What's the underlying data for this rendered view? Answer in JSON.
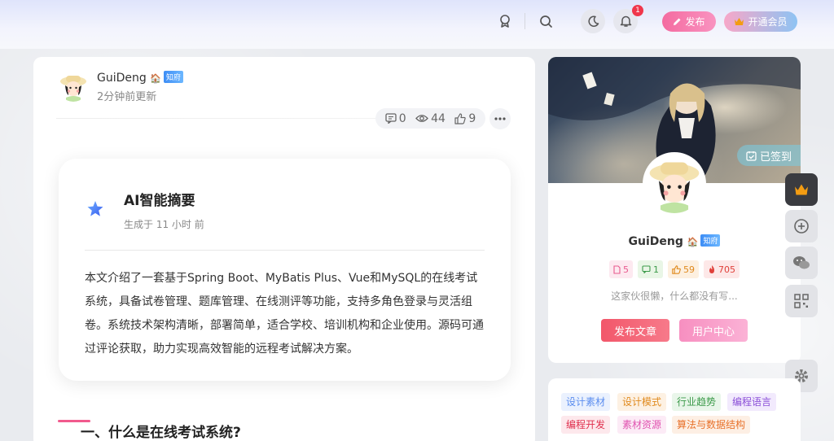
{
  "header": {
    "publish_label": "发布",
    "vip_label": "开通会员",
    "notification_count": "1"
  },
  "article": {
    "author": "GuiDeng",
    "author_badge": "知府",
    "update_time": "2分钟前更新",
    "comments": "0",
    "views": "44",
    "likes": "9",
    "ai_summary": {
      "title": "AI智能摘要",
      "subtitle": "生成于 11 小时 前",
      "body": "本文介绍了一套基于Spring Boot、MyBatis Plus、Vue和MySQL的在线考试系统，具备试卷管理、题库管理、在线测评等功能，支持多角色登录与灵活组卷。系统技术架构清晰，部署简单，适合学校、培训机构和企业使用。源码可通过评论获取，助力实现高效智能的远程考试解决方案。"
    },
    "section_title": "一、什么是在线考试系统?"
  },
  "profile": {
    "signed_label": "已签到",
    "name": "GuiDeng",
    "badge": "知府",
    "posts": "5",
    "comments": "1",
    "likes": "59",
    "hot": "705",
    "bio": "这家伙很懒，什么都没有写...",
    "publish_button": "发布文章",
    "center_button": "用户中心"
  },
  "tags": [
    {
      "label": "设计素材",
      "color": "#5b8def",
      "bg": "#eaf1fe"
    },
    {
      "label": "设计模式",
      "color": "#e08a1e",
      "bg": "#fdf1e3"
    },
    {
      "label": "行业趋势",
      "color": "#3c9a4a",
      "bg": "#e9f6ea"
    },
    {
      "label": "编程语言",
      "color": "#8b4fd8",
      "bg": "#f2eafd"
    },
    {
      "label": "编程开发",
      "color": "#e0304e",
      "bg": "#fde8ec"
    },
    {
      "label": "素材资源",
      "color": "#e052b0",
      "bg": "#fcebf6"
    },
    {
      "label": "算法与数据结构",
      "color": "#e8712a",
      "bg": "#fdefe4"
    }
  ],
  "colors": {
    "accent_pink": "#f15a8d",
    "publish_btn": "#f2576a",
    "center_btn": "#f78fc0"
  },
  "icons": [
    "medal-icon",
    "search-icon",
    "moon-icon",
    "bell-icon",
    "pen-icon",
    "crown-icon",
    "comment-icon",
    "eye-icon",
    "thumb-icon",
    "more-icon",
    "ai-star-icon",
    "calendar-check-icon",
    "plus-circle-icon",
    "wechat-icon",
    "qrcode-icon",
    "gear-icon",
    "file-icon",
    "fire-icon"
  ]
}
